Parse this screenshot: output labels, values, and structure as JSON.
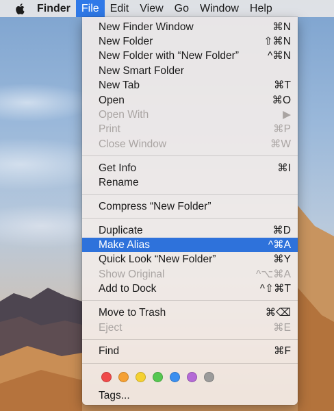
{
  "menubar": {
    "apple_icon": "apple-logo-icon",
    "items": [
      "Finder",
      "File",
      "Edit",
      "View",
      "Go",
      "Window",
      "Help"
    ],
    "active": "File"
  },
  "file_menu": {
    "items": [
      {
        "label": "New Finder Window",
        "shortcut": "⌘N",
        "enabled": true
      },
      {
        "label": "New Folder",
        "shortcut": "⇧⌘N",
        "enabled": true
      },
      {
        "label": "New Folder with “New Folder”",
        "shortcut": "^⌘N",
        "enabled": true
      },
      {
        "label": "New Smart Folder",
        "shortcut": "",
        "enabled": true
      },
      {
        "label": "New Tab",
        "shortcut": "⌘T",
        "enabled": true
      },
      {
        "label": "Open",
        "shortcut": "⌘O",
        "enabled": true
      },
      {
        "label": "Open With",
        "shortcut": "▶",
        "enabled": false
      },
      {
        "label": "Print",
        "shortcut": "⌘P",
        "enabled": false
      },
      {
        "label": "Close Window",
        "shortcut": "⌘W",
        "enabled": false
      },
      {
        "label": "Get Info",
        "shortcut": "⌘I",
        "enabled": true
      },
      {
        "label": "Rename",
        "shortcut": "",
        "enabled": true
      },
      {
        "label": "Compress “New Folder”",
        "shortcut": "",
        "enabled": true
      },
      {
        "label": "Duplicate",
        "shortcut": "⌘D",
        "enabled": true
      },
      {
        "label": "Make Alias",
        "shortcut": "^⌘A",
        "enabled": true,
        "highlighted": true
      },
      {
        "label": "Quick Look “New Folder”",
        "shortcut": "⌘Y",
        "enabled": true
      },
      {
        "label": "Show Original",
        "shortcut": "^⌥⌘A",
        "enabled": false
      },
      {
        "label": "Add to Dock",
        "shortcut": "^⇧⌘T",
        "enabled": true
      },
      {
        "label": "Move to Trash",
        "shortcut": "⌘⌫",
        "enabled": true
      },
      {
        "label": "Eject",
        "shortcut": "⌘E",
        "enabled": false
      },
      {
        "label": "Find",
        "shortcut": "⌘F",
        "enabled": true
      }
    ],
    "tag_colors": [
      {
        "name": "red",
        "hex": "#f04a4a"
      },
      {
        "name": "orange",
        "hex": "#f5a033"
      },
      {
        "name": "yellow",
        "hex": "#f5d131"
      },
      {
        "name": "green",
        "hex": "#56c751"
      },
      {
        "name": "blue",
        "hex": "#3b8ff0"
      },
      {
        "name": "purple",
        "hex": "#b46ad6"
      },
      {
        "name": "gray",
        "hex": "#9b9b9b"
      }
    ],
    "tags_label": "Tags..."
  },
  "colors": {
    "highlight": "#2e72db",
    "menubar_active": "#2f79e8",
    "disabled_text": "#a9a4a2"
  }
}
